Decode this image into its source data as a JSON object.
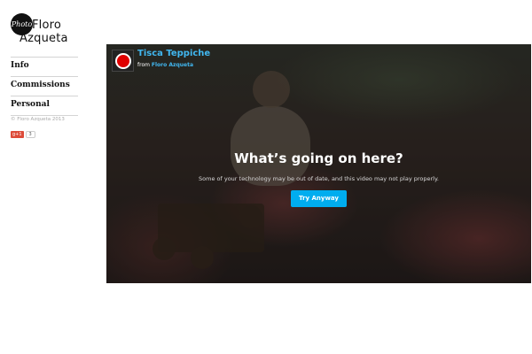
{
  "logo": {
    "badge_text": "Photo",
    "name_line1": "Floro",
    "name_line2": "Azqueta"
  },
  "nav": [
    {
      "label": "Info"
    },
    {
      "label": "Commissions"
    },
    {
      "label": "Personal"
    }
  ],
  "copyright": "© Floro Azqueta 2013",
  "social": {
    "gplus_label": "g+1",
    "gplus_count": "3"
  },
  "video": {
    "title": "Tisca Teppiche",
    "byline_prefix": "from",
    "author": "Floro Azqueta",
    "headline": "What’s going on here?",
    "message": "Some of your technology may be out of date, and this video may not play properly.",
    "button_label": "Try Anyway"
  },
  "colors": {
    "accent": "#41b7f0",
    "button": "#00adef",
    "record_dot": "#e00000"
  },
  "icons": [
    "record-icon",
    "google-plus-icon"
  ]
}
